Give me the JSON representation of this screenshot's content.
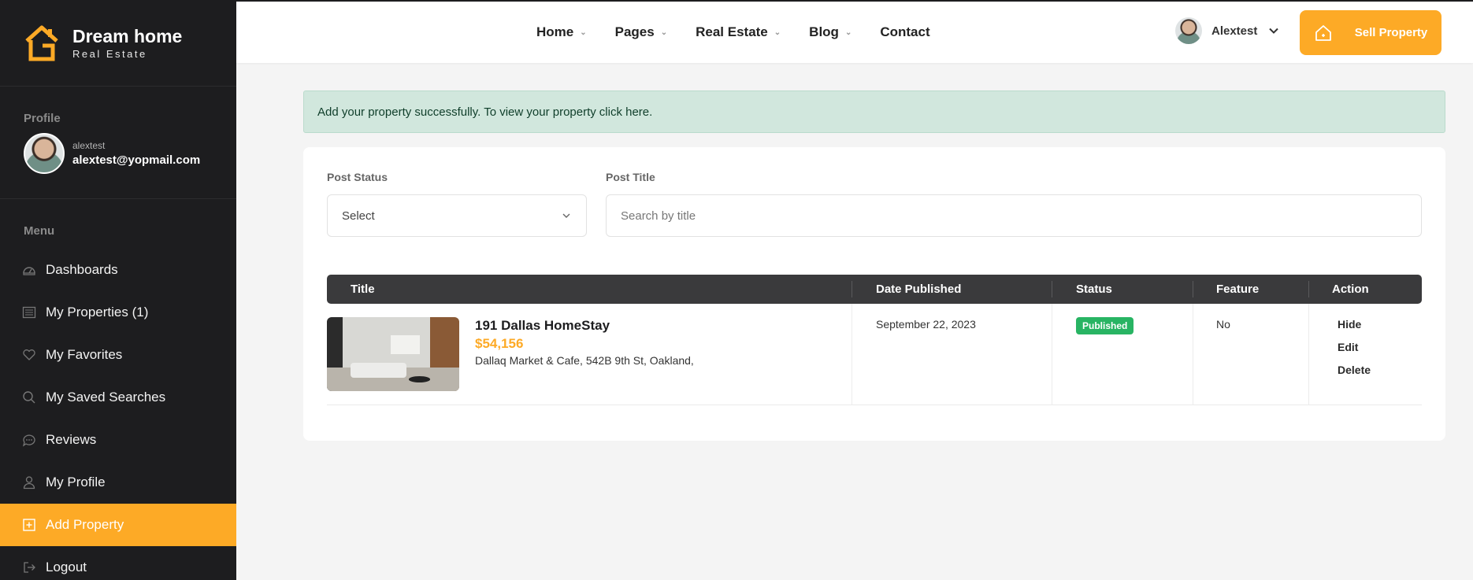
{
  "brand": {
    "name": "Dream home",
    "tagline": "Real Estate",
    "logo_icon": "house-logo-icon",
    "accent_color": "#fdaa26"
  },
  "profile": {
    "section_label": "Profile",
    "username": "alextest",
    "email": "alextest@yopmail.com"
  },
  "menu": {
    "label": "Menu",
    "items": [
      {
        "label": "Dashboards",
        "icon": "dashboard-icon"
      },
      {
        "label": "My Properties (1)",
        "icon": "list-icon"
      },
      {
        "label": "My Favorites",
        "icon": "heart-icon"
      },
      {
        "label": "My Saved Searches",
        "icon": "search-icon"
      },
      {
        "label": "Reviews",
        "icon": "chat-bubble-icon"
      },
      {
        "label": "My Profile",
        "icon": "user-icon"
      },
      {
        "label": "Add Property",
        "icon": "plus-square-icon",
        "active": true
      },
      {
        "label": "Logout",
        "icon": "logout-icon"
      }
    ]
  },
  "nav": {
    "items": [
      {
        "label": "Home",
        "has_dropdown": true
      },
      {
        "label": "Pages",
        "has_dropdown": true
      },
      {
        "label": "Real Estate",
        "has_dropdown": true
      },
      {
        "label": "Blog",
        "has_dropdown": true
      },
      {
        "label": "Contact",
        "has_dropdown": false
      }
    ],
    "user_name": "Alextest",
    "sell_button": "Sell Property"
  },
  "alert": {
    "message": "Add your property successfully. To view your property",
    "link_text": "click here."
  },
  "filters": {
    "status_label": "Post Status",
    "status_value": "Select",
    "title_label": "Post Title",
    "title_placeholder": "Search by title",
    "title_value": ""
  },
  "table": {
    "columns": [
      "Title",
      "Date Published",
      "Status",
      "Feature",
      "Action"
    ],
    "rows": [
      {
        "title": "191 Dallas HomeStay",
        "price": "$54,156",
        "address": "Dallaq Market & Cafe, 542B 9th St, Oakland,",
        "date_published": "September 22, 2023",
        "status": "Published",
        "status_color": "#28b463",
        "feature": "No",
        "actions": [
          "Hide",
          "Edit",
          "Delete"
        ]
      }
    ]
  }
}
